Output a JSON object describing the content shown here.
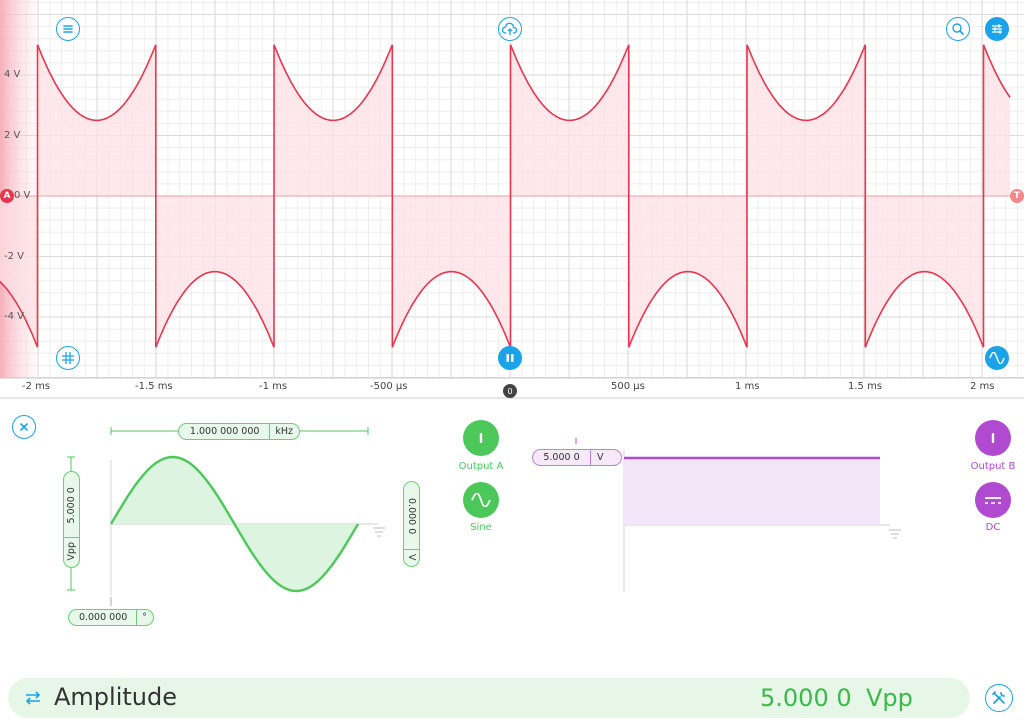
{
  "scope": {
    "y_axis_labels": [
      "4 V",
      "2 V",
      "0 V",
      "-2 V",
      "-4 V"
    ],
    "x_axis_labels": [
      "-2 ms",
      "-1.5 ms",
      "-1 ms",
      "-500 µs",
      "500 µs",
      "1 ms",
      "1.5 ms",
      "2 ms"
    ],
    "channel_marker": "A",
    "trigger_marker": "T",
    "zero_marker": "0",
    "trace_color": "#e8364f",
    "fill_color": "#fde0e4"
  },
  "chart_data": {
    "type": "line",
    "title": "",
    "xlabel": "",
    "ylabel": "",
    "x_unit": "ms",
    "y_unit": "V",
    "xlim": [
      -2.1,
      2.1
    ],
    "ylim": [
      -5.2,
      5.2
    ],
    "grid": true,
    "series": [
      {
        "description_points": [
          {
            "x": -2.1,
            "y": -3.0
          },
          {
            "x": -2.0,
            "y": -5.0
          },
          {
            "x": -2.0,
            "y": 5.0
          },
          {
            "x": -1.75,
            "y": 2.5
          },
          {
            "x": -1.5,
            "y": 5.0
          },
          {
            "x": -1.5,
            "y": -5.0
          },
          {
            "x": -1.25,
            "y": -2.5
          },
          {
            "x": -1.0,
            "y": -5.0
          },
          {
            "x": -1.0,
            "y": 5.0
          },
          {
            "x": -0.75,
            "y": 2.5
          },
          {
            "x": -0.5,
            "y": 5.0
          },
          {
            "x": -0.5,
            "y": -5.0
          },
          {
            "x": -0.25,
            "y": -2.5
          },
          {
            "x": 0.0,
            "y": -5.0
          },
          {
            "x": 0.0,
            "y": 5.0
          },
          {
            "x": 0.25,
            "y": 2.5
          },
          {
            "x": 0.5,
            "y": 5.0
          },
          {
            "x": 0.5,
            "y": -5.0
          },
          {
            "x": 0.75,
            "y": -2.5
          },
          {
            "x": 1.0,
            "y": -5.0
          },
          {
            "x": 1.0,
            "y": 5.0
          },
          {
            "x": 1.25,
            "y": 2.5
          },
          {
            "x": 1.5,
            "y": 5.0
          },
          {
            "x": 1.5,
            "y": -5.0
          },
          {
            "x": 1.75,
            "y": -2.5
          },
          {
            "x": 2.0,
            "y": -5.0
          },
          {
            "x": 2.0,
            "y": 5.0
          },
          {
            "x": 2.1,
            "y": 3.8
          }
        ]
      }
    ]
  },
  "output_a": {
    "frequency_value": "1.000 000 000",
    "frequency_unit": "kHz",
    "amplitude_value": "5.000 0",
    "amplitude_unit": "Vpp",
    "offset_value": "0.000 0",
    "offset_unit": "V",
    "phase_value": "0.000 000",
    "phase_unit": "°",
    "output_label": "Output A",
    "waveform_label": "Sine",
    "color": "#4cc85a"
  },
  "output_b": {
    "voltage_value": "5.000 0",
    "voltage_unit": "V",
    "output_label": "Output B",
    "waveform_label": "DC",
    "color": "#b04ad0"
  },
  "bottom_bar": {
    "param_name": "Amplitude",
    "param_value": "5.000 0",
    "param_unit": "Vpp"
  },
  "icons": [
    "menu-icon",
    "cloud-upload-icon",
    "zoom-icon",
    "sliders-icon",
    "grid-icon",
    "pause-icon",
    "sine-wave-icon",
    "close-icon",
    "swap-icon",
    "tools-icon",
    "power-icon",
    "dc-icon"
  ]
}
